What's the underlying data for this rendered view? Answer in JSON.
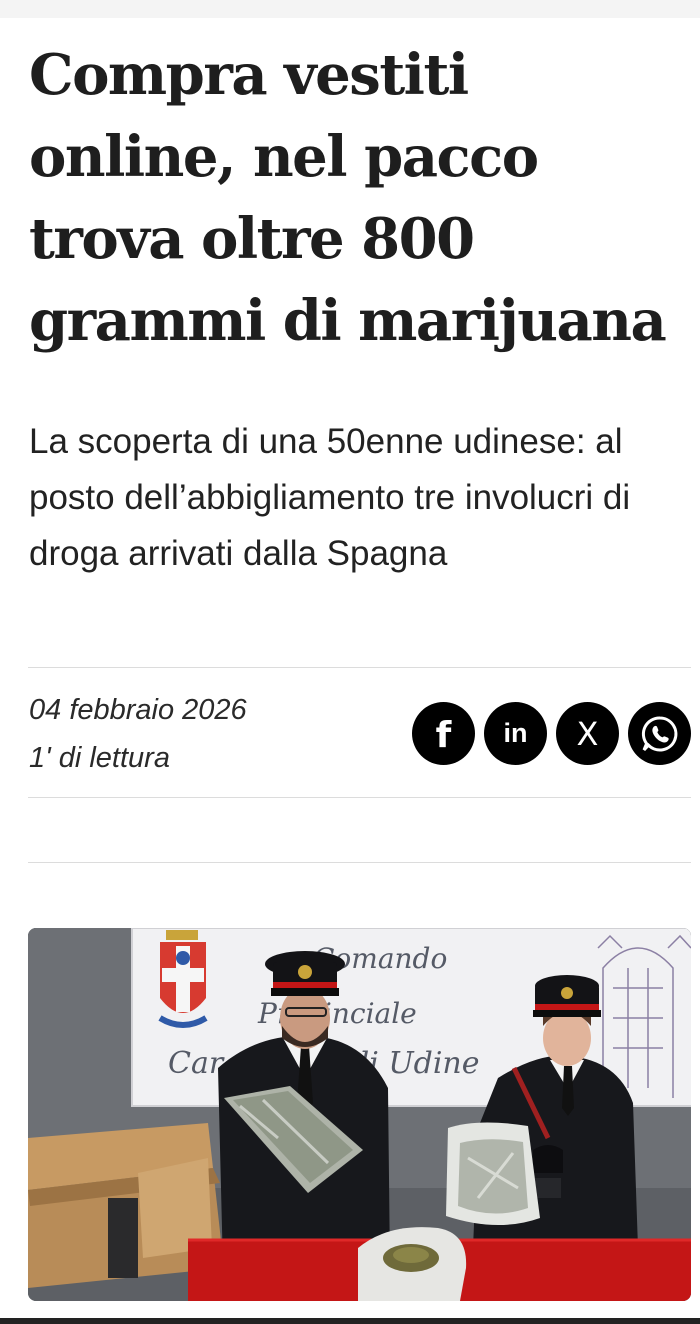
{
  "article": {
    "headline": "Compra vestiti online, nel pacco trova oltre 800 grammi di marijuana",
    "subtitle": "La scoperta di una 50enne udinese: al posto dell’abbigliamento tre involucri di droga arrivati dalla Spagna",
    "date": "04 febbraio 2026",
    "reading_time": "1' di lettura"
  },
  "share": {
    "facebook_label": "f",
    "linkedin_label": "in",
    "x_label": "X",
    "whatsapp_icon": "whatsapp-icon"
  },
  "photo": {
    "banner_line1": "Comando",
    "banner_line2": "Provinciale",
    "banner_line3": "Carabinieri di Udine",
    "colors": {
      "banner": "#f1f1f3",
      "uniform": "#17181c",
      "table": "#c41616",
      "box": "#b88c58",
      "wall": "#5d6065"
    }
  },
  "colors": {
    "text": "#1e1e1e",
    "divider": "#dcdcdc",
    "social_bg": "#000000"
  }
}
